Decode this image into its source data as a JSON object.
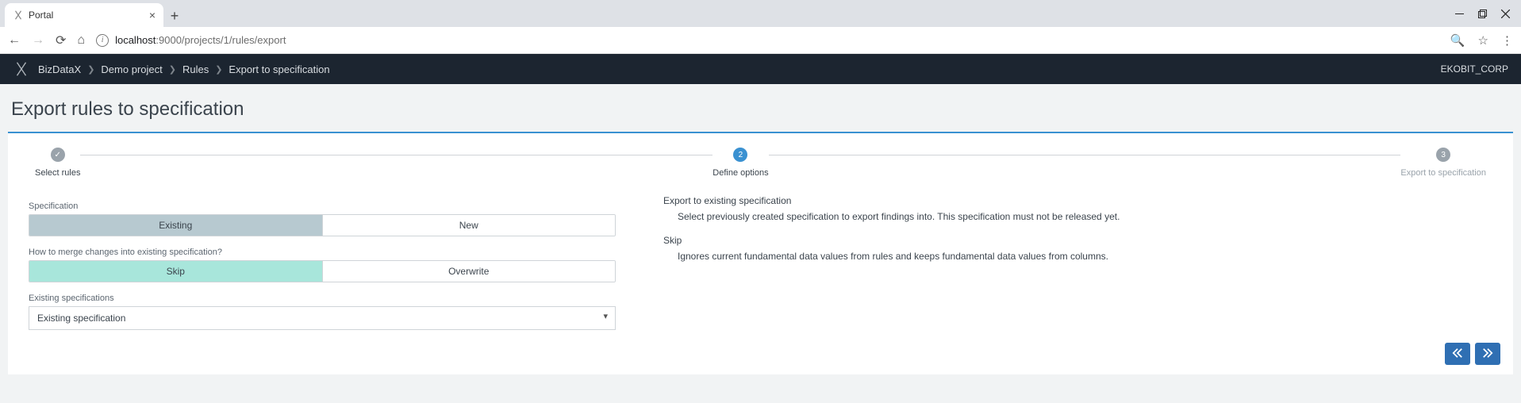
{
  "browser": {
    "tab_title": "Portal",
    "url_host": "localhost",
    "url_port_path": ":9000/projects/1/rules/export"
  },
  "header": {
    "crumbs": [
      "BizDataX",
      "Demo project",
      "Rules",
      "Export to specification"
    ],
    "user": "EKOBIT_CORP"
  },
  "page": {
    "title": "Export rules to specification"
  },
  "stepper": {
    "steps": [
      {
        "label": "Select rules",
        "state": "done",
        "marker": "✓"
      },
      {
        "label": "Define options",
        "state": "active",
        "marker": "2"
      },
      {
        "label": "Export to specification",
        "state": "future",
        "marker": "3"
      }
    ]
  },
  "form": {
    "spec_label": "Specification",
    "spec_options": {
      "existing": "Existing",
      "new": "New",
      "selected": "existing"
    },
    "merge_label": "How to merge changes into existing specification?",
    "merge_options": {
      "skip": "Skip",
      "overwrite": "Overwrite",
      "selected": "skip"
    },
    "existing_label": "Existing specifications",
    "existing_value": "Existing specification"
  },
  "help": {
    "export_title": "Export to existing specification",
    "export_desc": "Select previously created specification to export findings into. This specification must not be released yet.",
    "skip_title": "Skip",
    "skip_desc": "Ignores current fundamental data values from rules and keeps fundamental data values from columns."
  }
}
